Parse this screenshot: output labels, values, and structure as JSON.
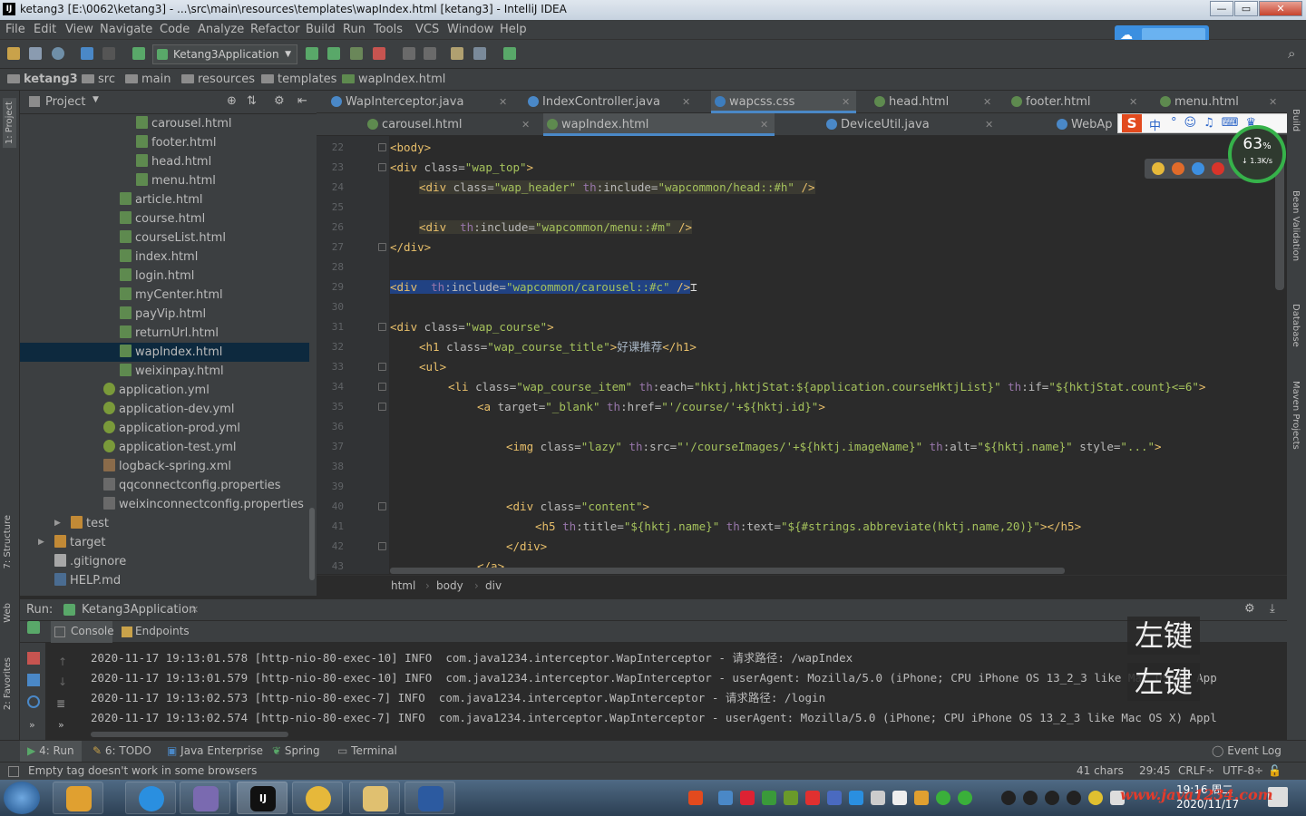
{
  "window": {
    "title": "ketang3 [E:\\0062\\ketang3] - ...\\src\\main\\resources\\templates\\wapIndex.html [ketang3] - IntelliJ IDEA",
    "min": "—",
    "max": "▭",
    "close": "✕"
  },
  "menu": [
    "File",
    "Edit",
    "View",
    "Navigate",
    "Code",
    "Analyze",
    "Refactor",
    "Build",
    "Run",
    "Tools",
    "VCS",
    "Window",
    "Help"
  ],
  "toolbar": {
    "run_config": "Ketang3Application"
  },
  "breadcrumb": [
    "ketang3",
    "src",
    "main",
    "resources",
    "templates",
    "wapIndex.html"
  ],
  "project": {
    "title": "Project",
    "items": [
      {
        "label": "carousel.html",
        "icon": "h",
        "indent": 3
      },
      {
        "label": "footer.html",
        "icon": "h",
        "indent": 3
      },
      {
        "label": "head.html",
        "icon": "h",
        "indent": 3
      },
      {
        "label": "menu.html",
        "icon": "h",
        "indent": 3
      },
      {
        "label": "article.html",
        "icon": "h",
        "indent": 2
      },
      {
        "label": "course.html",
        "icon": "h",
        "indent": 2
      },
      {
        "label": "courseList.html",
        "icon": "h",
        "indent": 2
      },
      {
        "label": "index.html",
        "icon": "h",
        "indent": 2
      },
      {
        "label": "login.html",
        "icon": "h",
        "indent": 2
      },
      {
        "label": "myCenter.html",
        "icon": "h",
        "indent": 2
      },
      {
        "label": "payVip.html",
        "icon": "h",
        "indent": 2
      },
      {
        "label": "returnUrl.html",
        "icon": "h",
        "indent": 2
      },
      {
        "label": "wapIndex.html",
        "icon": "h",
        "indent": 2,
        "selected": true
      },
      {
        "label": "weixinpay.html",
        "icon": "h",
        "indent": 2
      },
      {
        "label": "application.yml",
        "icon": "y",
        "indent": 1
      },
      {
        "label": "application-dev.yml",
        "icon": "y",
        "indent": 1
      },
      {
        "label": "application-prod.yml",
        "icon": "y",
        "indent": 1
      },
      {
        "label": "application-test.yml",
        "icon": "y",
        "indent": 1
      },
      {
        "label": "logback-spring.xml",
        "icon": "x",
        "indent": 1
      },
      {
        "label": "qqconnectconfig.properties",
        "icon": "p",
        "indent": 1
      },
      {
        "label": "weixinconnectconfig.properties",
        "icon": "p",
        "indent": 1
      },
      {
        "label": "test",
        "icon": "d",
        "indent": 0,
        "arrow": "▶"
      },
      {
        "label": "target",
        "icon": "d",
        "indent": -1,
        "arrow": "▶"
      },
      {
        "label": ".gitignore",
        "icon": "t",
        "indent": -1
      },
      {
        "label": "HELP.md",
        "icon": "m",
        "indent": -1
      }
    ]
  },
  "tabs_row1": [
    {
      "label": "WapInterceptor.java",
      "color": "#4a88c7"
    },
    {
      "label": "IndexController.java",
      "color": "#4a88c7"
    },
    {
      "label": "wapcss.css",
      "color": "#3d7dbd",
      "selected": true
    },
    {
      "label": "head.html",
      "color": "#5e8a4f"
    },
    {
      "label": "footer.html",
      "color": "#5e8a4f"
    },
    {
      "label": "menu.html",
      "color": "#5e8a4f"
    }
  ],
  "tabs_row2": [
    {
      "label": "carousel.html",
      "color": "#5e8a4f"
    },
    {
      "label": "wapIndex.html",
      "color": "#5e8a4f",
      "selected": true
    },
    {
      "label": "DeviceUtil.java",
      "color": "#4a88c7"
    },
    {
      "label": "WebAp",
      "color": "#4a88c7"
    }
  ],
  "code": {
    "line_numbers": [
      "22",
      "23",
      "24",
      "25",
      "26",
      "27",
      "28",
      "29",
      "30",
      "31",
      "32",
      "33",
      "34",
      "35",
      "36",
      "37",
      "38",
      "39",
      "40",
      "41",
      "42",
      "43"
    ],
    "l22": "<body>",
    "l23a": "<div ",
    "l23b": "class=",
    "l23c": "\"wap_top\"",
    "l23d": ">",
    "l24a": "<div ",
    "l24b": "class=",
    "l24c": "\"wap_header\" ",
    "l24d": "th",
    "l24e": ":include=",
    "l24f": "\"wapcommon/head::#h\"",
    "l24g": " />",
    "l26a": "<div  ",
    "l26b": "th",
    "l26c": ":include=",
    "l26d": "\"wapcommon/menu::#m\"",
    "l26e": " />",
    "l27": "</div>",
    "l29a": "<div  ",
    "l29b": "th",
    "l29c": ":include=",
    "l29d": "\"wapcommon/carousel::#c\"",
    "l29e": " />",
    "l31a": "<div ",
    "l31b": "class=",
    "l31c": "\"wap_course\"",
    "l31d": ">",
    "l32a": "<h1 ",
    "l32b": "class=",
    "l32c": "\"wap_course_title\"",
    "l32d": ">",
    "l32e": "好课推荐",
    "l32f": "</h1>",
    "l33": "<ul>",
    "l34a": "<li ",
    "l34b": "class=",
    "l34c": "\"wap_course_item\" ",
    "l34d": "th",
    "l34e": ":each=",
    "l34f": "\"hktj,hktjStat:${application.courseHktjList}\" ",
    "l34g": "th",
    "l34h": ":if=",
    "l34i": "\"${hktjStat.count}<=6\"",
    "l34j": ">",
    "l35a": "<a ",
    "l35b": "target=",
    "l35c": "\"_blank\" ",
    "l35d": "th",
    "l35e": ":href=",
    "l35f": "\"'/course/'+${hktj.id}\"",
    "l35g": ">",
    "l37a": "<img ",
    "l37b": "class=",
    "l37c": "\"lazy\" ",
    "l37d": "th",
    "l37e": ":src=",
    "l37f": "\"'/courseImages/'+${hktj.imageName}\" ",
    "l37g": "th",
    "l37h": ":alt=",
    "l37i": "\"${hktj.name}\" ",
    "l37j": "style=",
    "l37k": "\"...\"",
    "l37l": ">",
    "l40a": "<div ",
    "l40b": "class=",
    "l40c": "\"content\"",
    "l40d": ">",
    "l41a": "<h5 ",
    "l41b": "th",
    "l41c": ":title=",
    "l41d": "\"${hktj.name}\" ",
    "l41e": "th",
    "l41f": ":text=",
    "l41g": "\"${#strings.abbreviate(hktj.name,20)}\"",
    "l41h": "></h5>",
    "l42": "</div>",
    "l43": "</a>"
  },
  "editor_crumbs": [
    "html",
    "body",
    "div"
  ],
  "run": {
    "label": "Run:",
    "config": "Ketang3Application",
    "tab_console": "Console",
    "tab_endpoints": "Endpoints",
    "logs": [
      "2020-11-17 19:13:01.578 [http-nio-80-exec-10] INFO  com.java1234.interceptor.WapInterceptor - 请求路径: /wapIndex",
      "2020-11-17 19:13:01.579 [http-nio-80-exec-10] INFO  com.java1234.interceptor.WapInterceptor - userAgent: Mozilla/5.0 (iPhone; CPU iPhone OS 13_2_3 like Mac OS X) App",
      "2020-11-17 19:13:02.573 [http-nio-80-exec-7] INFO  com.java1234.interceptor.WapInterceptor - 请求路径: /login",
      "2020-11-17 19:13:02.574 [http-nio-80-exec-7] INFO  com.java1234.interceptor.WapInterceptor - userAgent: Mozilla/5.0 (iPhone; CPU iPhone OS 13_2_3 like Mac OS X) Appl"
    ]
  },
  "key_overlay": [
    "左键",
    "左键"
  ],
  "bottom_tabs": [
    "4: Run",
    "6: TODO",
    "Java Enterprise",
    "Spring",
    "Terminal"
  ],
  "event_log": "Event Log",
  "left_vtabs": [
    "1: Project",
    "7: Structure",
    "Web",
    "2: Favorites"
  ],
  "right_vtabs": [
    "Build",
    "Bean Validation",
    "Database",
    "Maven Projects"
  ],
  "status": {
    "message": "Empty tag doesn't work in some browsers",
    "chars": "41 chars",
    "position": "29:45",
    "line_sep": "CRLF÷",
    "encoding": "UTF-8÷"
  },
  "net_widget": {
    "percent": "63",
    "unit": "%",
    "speed": "↓ 1.3K/s"
  },
  "taskbar": {
    "time": "19:16 周二",
    "date": "2020/11/17",
    "watermark": "www.java1234.com"
  },
  "ime": {
    "s": "S",
    "zh": "中"
  }
}
